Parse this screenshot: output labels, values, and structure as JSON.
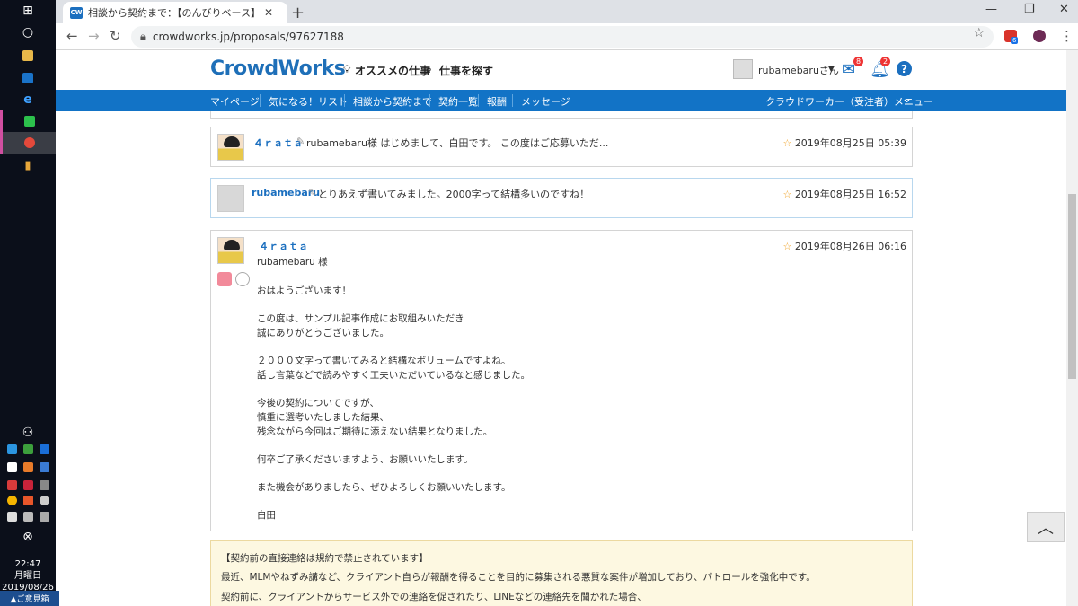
{
  "taskbar": {
    "clock_time": "22:47",
    "clock_day": "月曜日",
    "clock_date": "2019/08/26"
  },
  "browser": {
    "tab_title": "相談から契約まで：【のんびりベース】",
    "favicon_text": "CW",
    "url": "crowdworks.jp/proposals/97627188",
    "ext_badge": "6"
  },
  "site": {
    "logo": "CrowdWorks",
    "nav_recommended": "オススメの仕事",
    "nav_search": "仕事を探す",
    "user_name": "rubamebaruさん",
    "mail_count": "8",
    "notif_count": "2",
    "help": "?",
    "menu": [
      "マイページ",
      "気になる！リスト",
      "相談から契約まで",
      "契約一覧",
      "報酬",
      "メッセージ"
    ],
    "menu_right": "クラウドワーカー（受注者）メニュー"
  },
  "messages": [
    {
      "sender": "４ｒａｔａ",
      "snippet": "rubamebaru様 はじめまして、白田です。 この度はご応募いただ...",
      "date": "2019年08月25日 05:39"
    },
    {
      "sender": "rubamebaru",
      "snippet": "とりあえず書いてみました。2000字って結構多いのですね！",
      "date": "2019年08月25日 16:52"
    },
    {
      "sender": "４ｒａｔａ",
      "date": "2019年08月26日 06:16",
      "lines": [
        "rubamebaru 様",
        "おはようございます！",
        "この度は、サンプル記事作成にお取組みいただき",
        "誠にありがとうございました。",
        "２０００文字って書いてみると結構なボリュームですよね。",
        "話し言葉などで読みやすく工夫いただいているなと感じました。",
        "今後の契約についてですが、",
        "慎重に選考いたしました結果、",
        "残念ながら今回はご期待に添えない結果となりました。",
        "何卒ご了承くださいますよう、お願いいたします。",
        "また機会がありましたら、ぜひよろしくお願いいたします。",
        "白田"
      ]
    }
  ],
  "notice": {
    "title": "【契約前の直接連絡は規約で禁止されています】",
    "line1": "最近、MLMやねずみ講など、クライアント自らが報酬を得ることを目的に募集される悪質な案件が増加しており、パトロールを強化中です。",
    "line2": "契約前に、クライアントからサービス外での連絡を促されたり、LINEなどの連絡先を聞かれた場合、"
  },
  "feedback_label": "▲ご意見箱",
  "totop_label": "︿"
}
